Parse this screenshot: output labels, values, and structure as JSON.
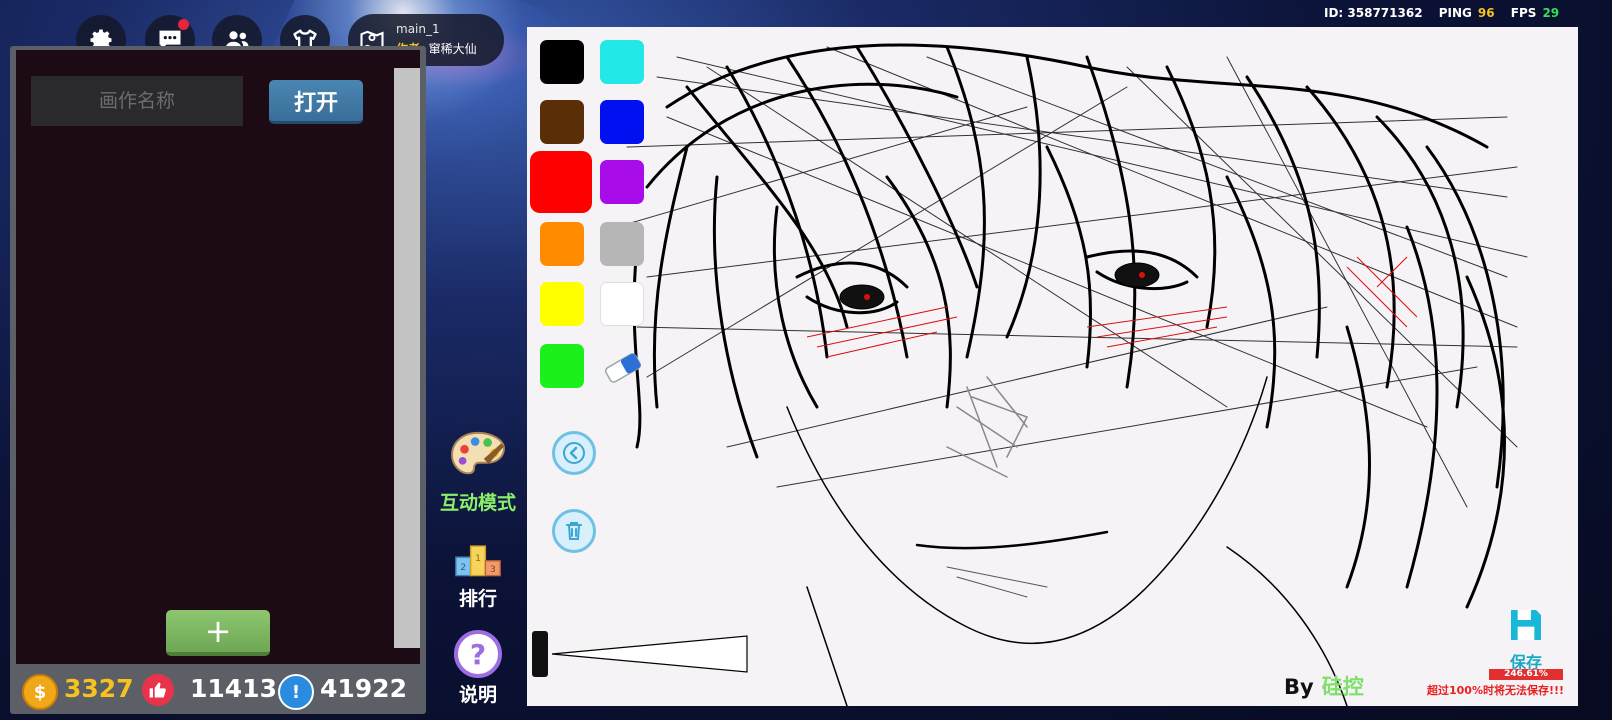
{
  "header": {
    "map_name": "main_1",
    "author_label": "作者:",
    "author_name": "窜稀大仙",
    "id_text": "ID: 358771362",
    "ping_label": "PING",
    "ping_value": "96",
    "fps_label": "FPS",
    "fps_value": "29",
    "icons": [
      "gear-icon",
      "chat-icon",
      "friends-icon",
      "wardrobe-icon",
      "map-pin-icon"
    ]
  },
  "left_panel": {
    "name_input_placeholder": "画作名称",
    "name_input_value": "",
    "open_button": "打开",
    "add_button": "+",
    "stats": {
      "coins": "3327",
      "likes": "11413.8",
      "alerts": "41922"
    }
  },
  "modes": {
    "interactive": "互动模式",
    "ranking": "排行",
    "help": "说明"
  },
  "palette": {
    "colors": [
      "#000000",
      "#22e8e8",
      "#5a2e06",
      "#0010f0",
      "#ff0000",
      "#a80ce8",
      "#ff8c00",
      "#b6b6b6",
      "#ffff00",
      "#ffffff",
      "#1af01a"
    ],
    "selected": "#ff0000",
    "eraser": "eraser-icon"
  },
  "canvas": {
    "by_label": "By",
    "artist": "硅控",
    "save_label": "保存",
    "progress": "246.61%",
    "warning": "超过100%时将无法保存!!!"
  }
}
